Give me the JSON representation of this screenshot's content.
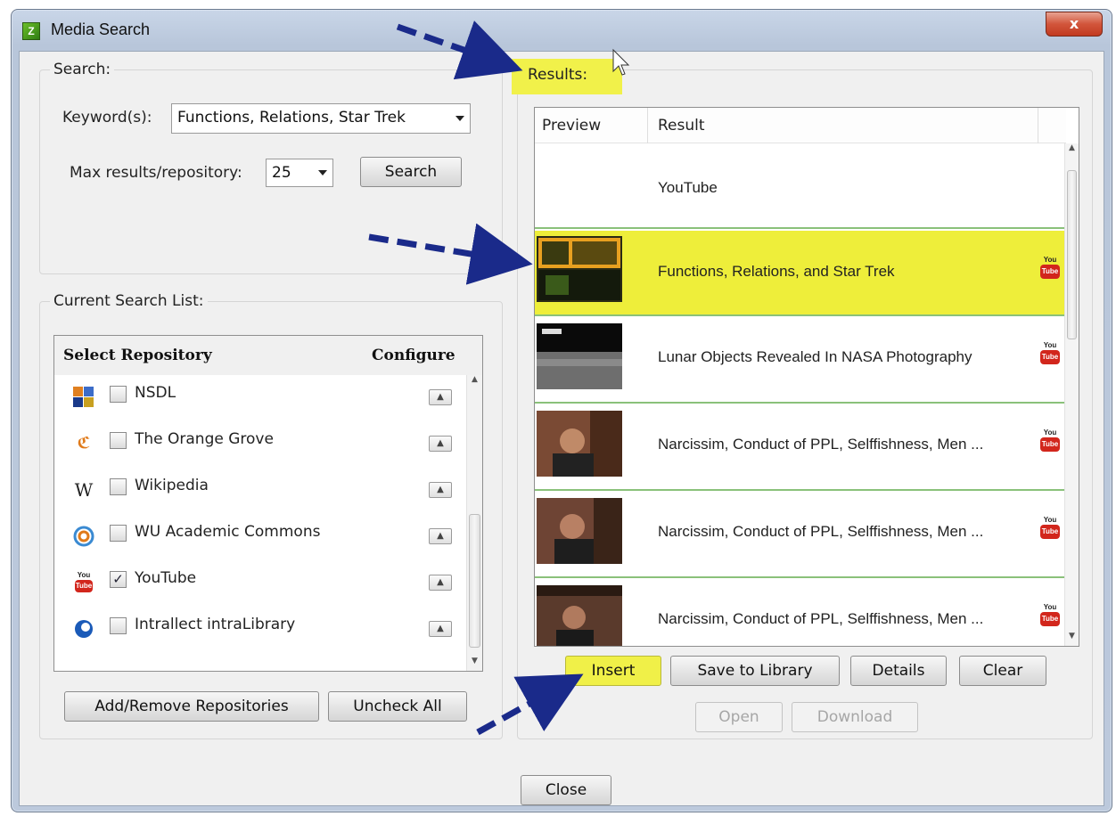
{
  "window": {
    "title": "Media Search",
    "close_glyph": "x"
  },
  "search": {
    "group_label": "Search:",
    "keyword_label": "Keyword(s):",
    "keyword_value": "Functions, Relations, Star Trek",
    "max_label": "Max results/repository:",
    "max_value": "25",
    "search_button": "Search"
  },
  "search_list": {
    "group_label": "Current Search List:",
    "col_select": "Select Repository",
    "col_configure": "Configure",
    "repositories": [
      {
        "label": "NSDL",
        "checked": false,
        "icon": "nsdl-icon"
      },
      {
        "label": "The Orange Grove",
        "checked": false,
        "icon": "orange-grove-icon"
      },
      {
        "label": "Wikipedia",
        "checked": false,
        "icon": "wikipedia-icon"
      },
      {
        "label": "WU Academic Commons",
        "checked": false,
        "icon": "wu-commons-icon"
      },
      {
        "label": "YouTube",
        "checked": true,
        "icon": "youtube-icon"
      },
      {
        "label": "Intrallect intraLibrary",
        "checked": false,
        "icon": "intralibrary-icon"
      }
    ],
    "add_remove_button": "Add/Remove Repositories",
    "uncheck_all_button": "Uncheck All"
  },
  "results": {
    "group_label": "Results:",
    "col_preview": "Preview",
    "col_result": "Result",
    "rows": [
      {
        "title": "YouTube",
        "has_thumb": false,
        "source": ""
      },
      {
        "title": "Functions, Relations, and Star Trek",
        "has_thumb": true,
        "source": "youtube",
        "selected": true
      },
      {
        "title": "Lunar Objects Revealed In NASA Photography",
        "has_thumb": true,
        "source": "youtube"
      },
      {
        "title": "Narcissim, Conduct of PPL, Selffishness, Men ...",
        "has_thumb": true,
        "source": "youtube"
      },
      {
        "title": "Narcissim, Conduct of PPL, Selffishness, Men ...",
        "has_thumb": true,
        "source": "youtube"
      },
      {
        "title": "Narcissim, Conduct of PPL, Selffishness, Men ...",
        "has_thumb": true,
        "source": "youtube"
      }
    ],
    "yt_you": "You",
    "yt_tube": "Tube",
    "insert_button": "Insert",
    "save_button": "Save to Library",
    "details_button": "Details",
    "clear_button": "Clear",
    "open_button": "Open",
    "download_button": "Download"
  },
  "footer": {
    "close_button": "Close"
  },
  "colors": {
    "highlight": "#f0f048",
    "row_separator": "#8ac17a",
    "arrow": "#1a2a8a"
  }
}
